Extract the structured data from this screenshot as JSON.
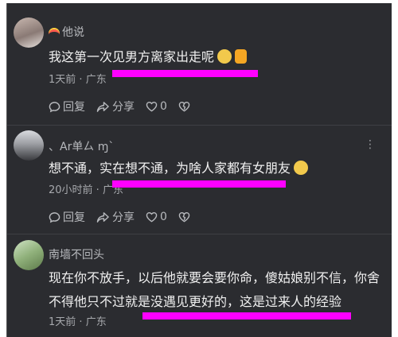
{
  "comments": [
    {
      "username": "他说",
      "text": "我这第一次见男方离家出走呢",
      "time": "1天前",
      "location": "广东",
      "actions": {
        "reply": "回复",
        "share": "分享",
        "likes": "0"
      }
    },
    {
      "username": "、Ar单ㄙ ɱ`",
      "text": "想不通，实在想不通，为啥人家都有女朋友",
      "time": "20小时前",
      "location": "广东",
      "actions": {
        "reply": "回复",
        "share": "分享",
        "likes": "0"
      }
    },
    {
      "username": "南墙不回头",
      "text_line1": "现在你不放手，以后他就要会要你命，傻姑娘别不信，你舍",
      "text_line2": "不得他只不过就是没遇见更好的，这是过来人的经验",
      "time": "1天前",
      "location": "广东"
    }
  ],
  "colors": {
    "background": "#2b2c30",
    "highlight": "#ff00ff"
  },
  "icons": [
    "reply-icon",
    "share-icon",
    "heart-icon",
    "broken-heart-icon",
    "more-icon"
  ]
}
